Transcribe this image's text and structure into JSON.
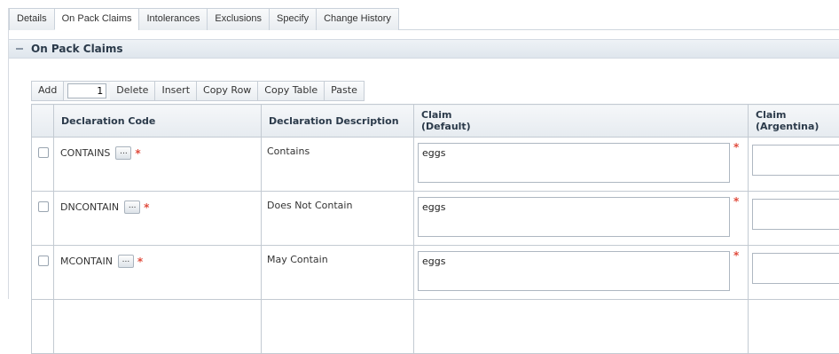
{
  "tabs": [
    {
      "label": "Details",
      "active": false
    },
    {
      "label": "On Pack Claims",
      "active": true
    },
    {
      "label": "Intolerances",
      "active": false
    },
    {
      "label": "Exclusions",
      "active": false
    },
    {
      "label": "Specify",
      "active": false
    },
    {
      "label": "Change History",
      "active": false
    }
  ],
  "section": {
    "title": "On Pack Claims",
    "collapse_icon": "minus-collapse-icon"
  },
  "toolbar": {
    "add_label": "Add",
    "count_value": "1",
    "delete_label": "Delete",
    "insert_label": "Insert",
    "copy_row_label": "Copy Row",
    "copy_table_label": "Copy Table",
    "paste_label": "Paste"
  },
  "table": {
    "headers": {
      "code": "Declaration Code",
      "description": "Declaration Description",
      "claim_default_1": "Claim",
      "claim_default_2": "(Default)",
      "claim_arg_1": "Claim",
      "claim_arg_2": "(Argentina)"
    },
    "lookup_label": "...",
    "required_marker": "*",
    "rows": [
      {
        "code": "CONTAINS",
        "description": "Contains",
        "claim_default": "eggs",
        "claim_argentina": ""
      },
      {
        "code": "DNCONTAIN",
        "description": "Does Not Contain",
        "claim_default": "eggs",
        "claim_argentina": ""
      },
      {
        "code": "MCONTAIN",
        "description": "May Contain",
        "claim_default": "eggs",
        "claim_argentina": ""
      }
    ]
  },
  "colors": {
    "required": "#e04b3c",
    "header_bg": "#e6ebf0",
    "border": "#c3cad2"
  }
}
